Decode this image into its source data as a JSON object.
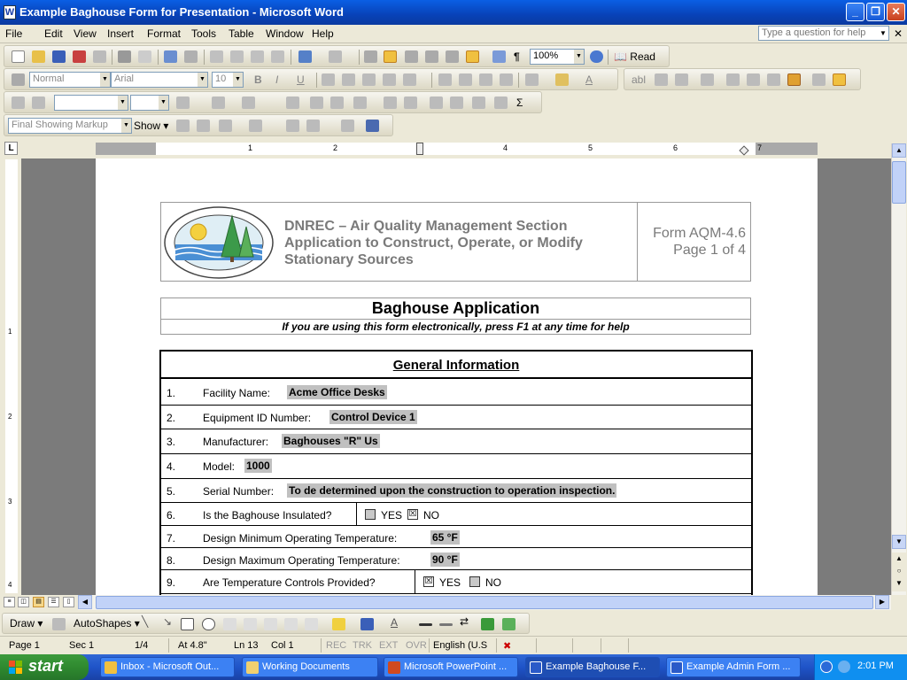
{
  "window": {
    "title": "Example Baghouse Form for Presentation - Microsoft Word"
  },
  "menu": [
    "File",
    "Edit",
    "View",
    "Insert",
    "Format",
    "Tools",
    "Table",
    "Window",
    "Help"
  ],
  "help_box": {
    "placeholder": "Type a question for help"
  },
  "toolbar": {
    "zoom": "100%",
    "read_label": "Read",
    "style": "Normal",
    "font": "Arial",
    "size": "10",
    "markup_view": "Final Showing Markup",
    "show_label": "Show"
  },
  "ruler": {
    "numbers": [
      "1",
      "2",
      "3",
      "4",
      "5",
      "6",
      "7"
    ]
  },
  "vruler": {
    "numbers": [
      "1",
      "2",
      "3",
      "4"
    ]
  },
  "form": {
    "agency_line1": "DNREC – Air Quality Management Section",
    "agency_line2": "Application to Construct, Operate, or Modify",
    "agency_line3": "Stationary Sources",
    "form_id": "Form AQM-4.6",
    "page_of": "Page 1 of 4",
    "title": "Baghouse Application",
    "subtitle": "If you are using this form electronically, press F1 at any time for help",
    "section": "General Information",
    "yes": "YES",
    "no": "NO",
    "rows": [
      {
        "num": "1.",
        "label": "Facility Name:",
        "value": "Acme Office Desks"
      },
      {
        "num": "2.",
        "label": "Equipment ID Number:",
        "value": "Control Device 1"
      },
      {
        "num": "3.",
        "label": "Manufacturer:",
        "value": "Baghouses \"R\" Us"
      },
      {
        "num": "4.",
        "label": "Model:",
        "value": "1000"
      },
      {
        "num": "5.",
        "label": "Serial Number:",
        "value": "To de determined upon the construction to operation inspection."
      },
      {
        "num": "6.",
        "label": "Is the Baghouse Insulated?",
        "value": ""
      },
      {
        "num": "7.",
        "label": "Design Minimum Operating Temperature:",
        "value": "65 °F"
      },
      {
        "num": "8.",
        "label": "Design Maximum Operating Temperature:",
        "value": "90 °F"
      },
      {
        "num": "9.",
        "label": "Are Temperature Controls Provided?",
        "value": ""
      }
    ]
  },
  "drawbar": {
    "draw_label": "Draw",
    "autoshapes_label": "AutoShapes"
  },
  "status": {
    "page": "Page 1",
    "sec": "Sec 1",
    "pages": "1/4",
    "at": "At  4.8\"",
    "ln": "Ln 13",
    "col": "Col 1",
    "rec": "REC",
    "trk": "TRK",
    "ext": "EXT",
    "ovr": "OVR",
    "lang": "English (U.S"
  },
  "taskbar": {
    "start": "start",
    "tasks": [
      "Inbox - Microsoft Out...",
      "Working Documents",
      "Microsoft PowerPoint ...",
      "Example Baghouse F...",
      "Example Admin Form ..."
    ],
    "clock": "2:01 PM"
  }
}
